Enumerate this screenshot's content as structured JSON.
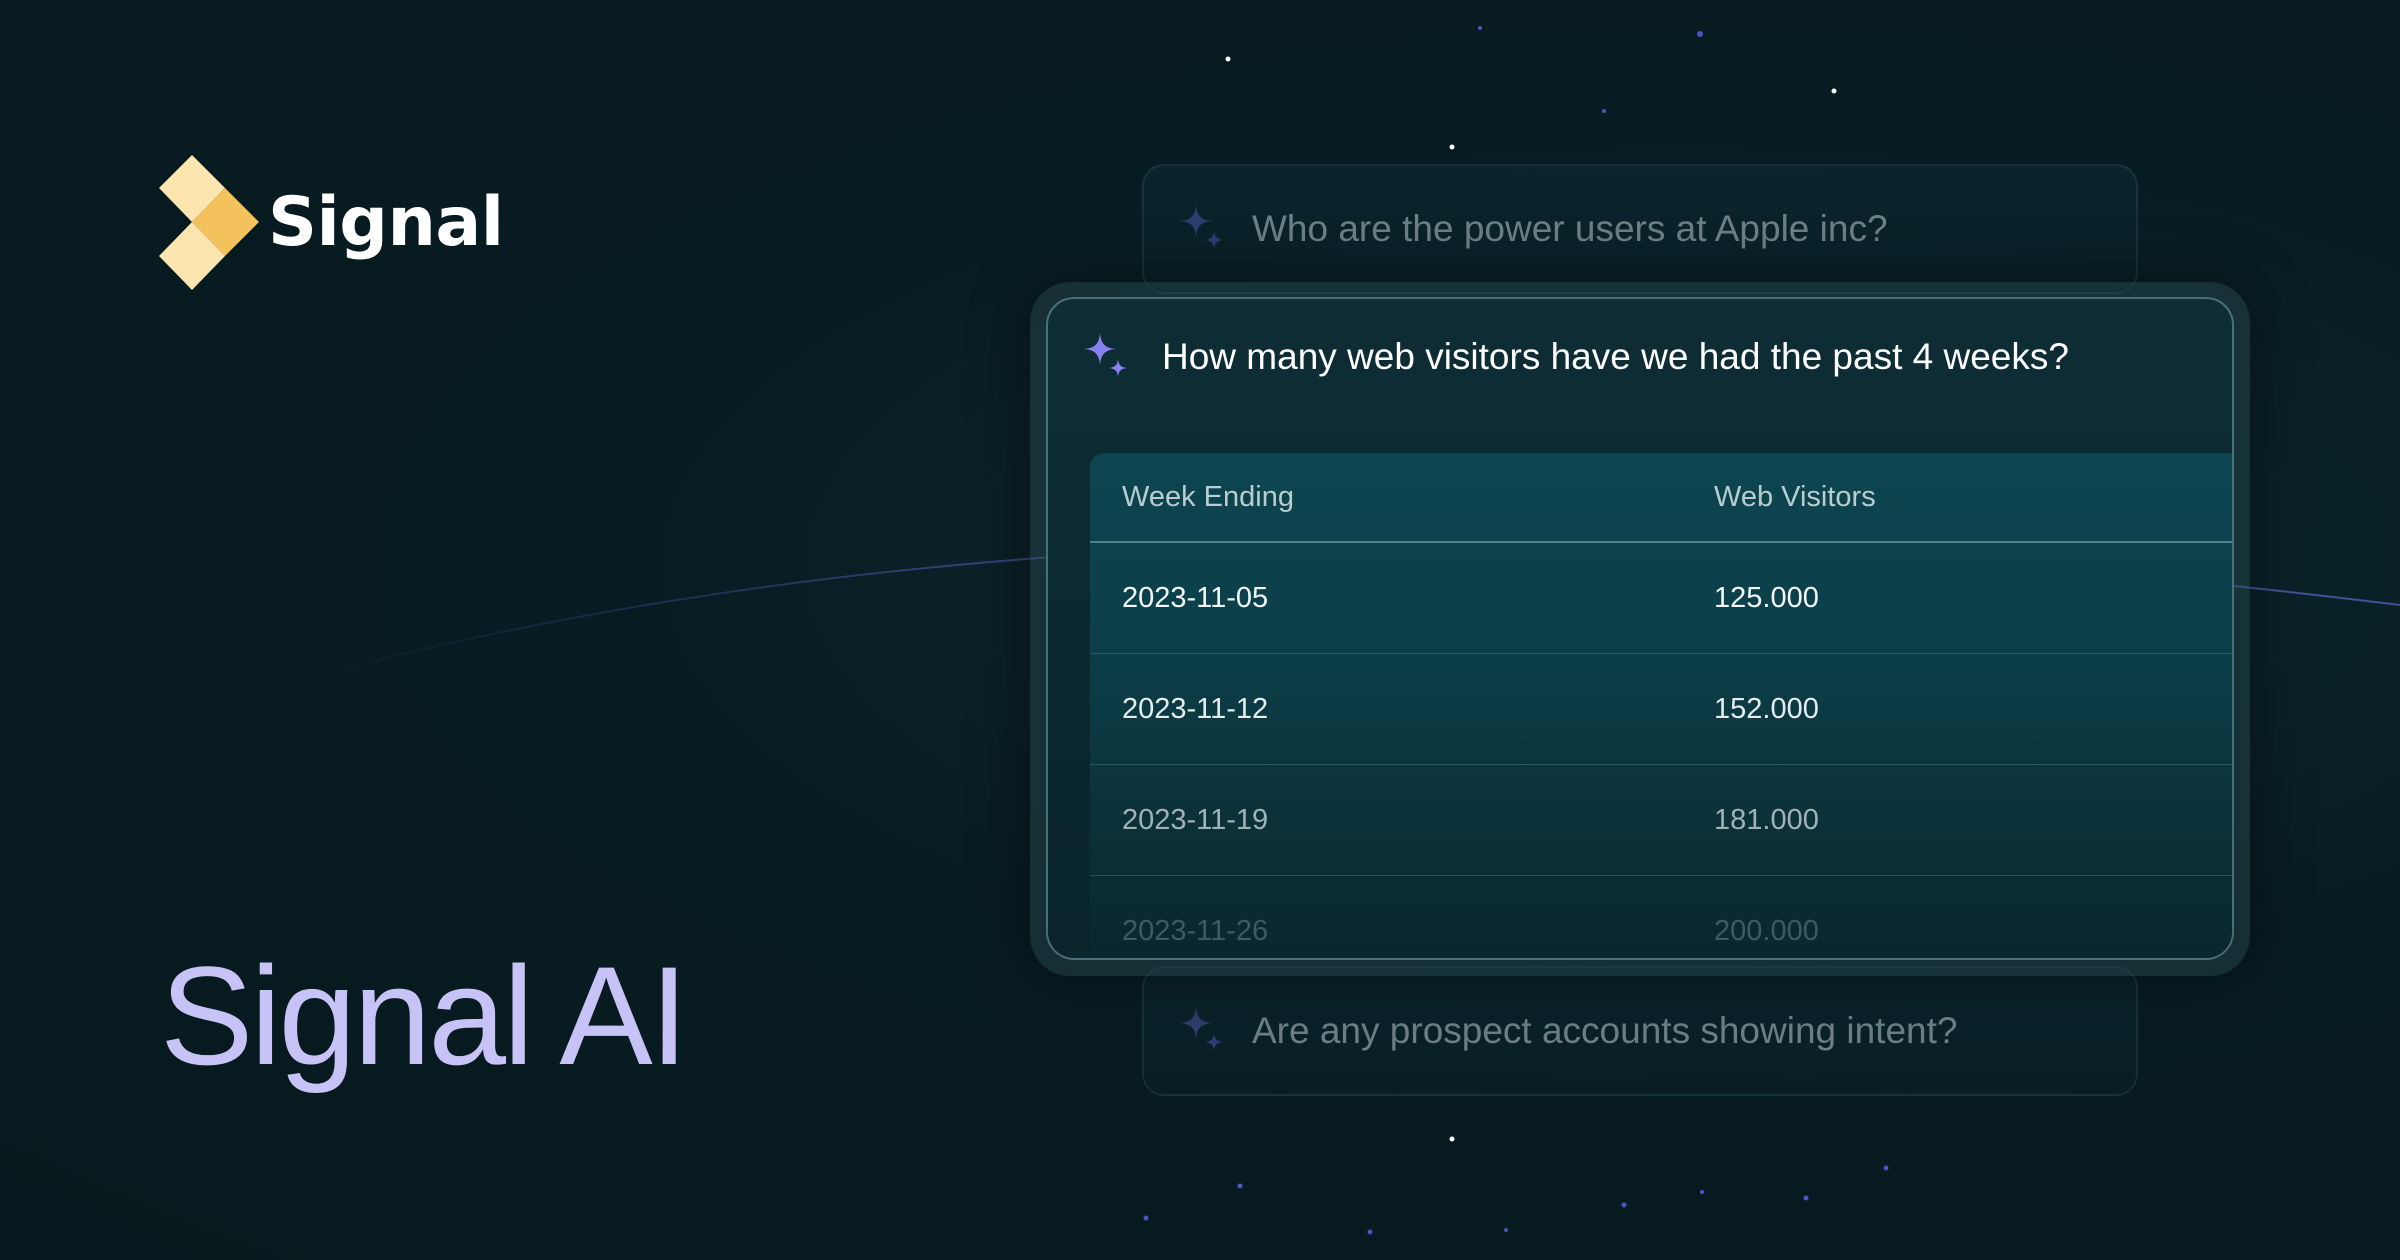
{
  "brand": {
    "name": "Signal",
    "colors": {
      "logo_light": "#fde5b0",
      "logo_accent": "#f4c25c",
      "title": "#c7c3f6",
      "sparkle": "#8b80f0"
    }
  },
  "hero": {
    "title": "Signal AI"
  },
  "ghost_questions": {
    "top": "Who are the power users at Apple inc?",
    "bottom": "Are any prospect accounts showing intent?"
  },
  "main_card": {
    "question": "How many web visitors have we had the past 4 weeks?",
    "table": {
      "columns": [
        "Week Ending",
        "Web Visitors"
      ],
      "rows": [
        [
          "2023-11-05",
          "125.000"
        ],
        [
          "2023-11-12",
          "152.000"
        ],
        [
          "2023-11-19",
          "181.000"
        ],
        [
          "2023-11-26",
          "200.000"
        ]
      ]
    }
  },
  "icons": {
    "logo": "signal-logo-icon",
    "sparkle": "sparkle-icon"
  }
}
